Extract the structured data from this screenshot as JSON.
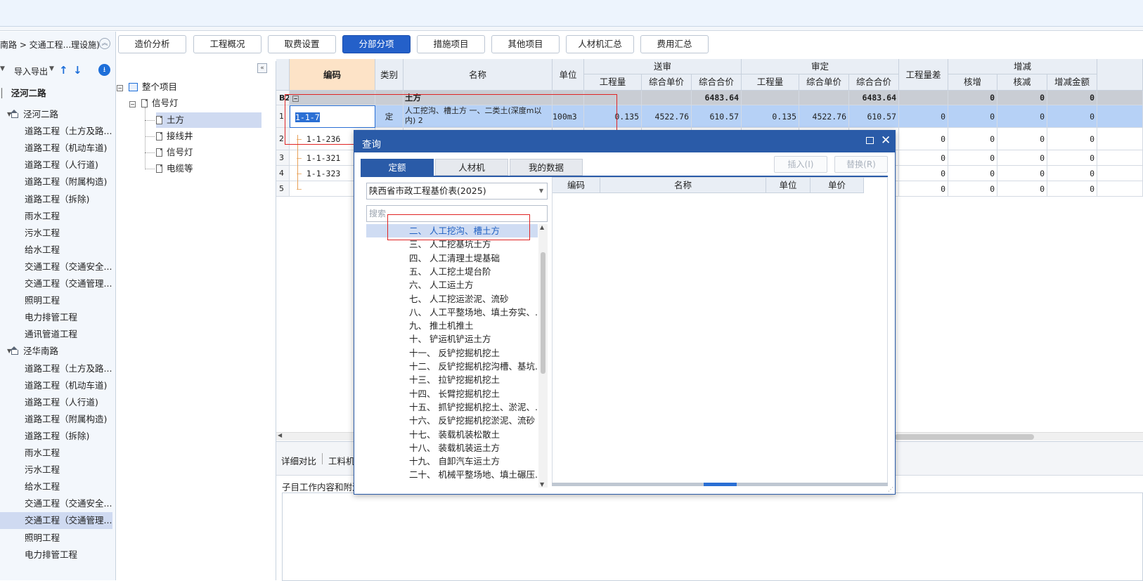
{
  "breadcrumb": "南路 > 交通工程...理设施)",
  "sidebar_toolbar": {
    "io_label": "导入导出"
  },
  "left_tree": [
    {
      "label": "泾河二路",
      "kind": "root"
    },
    {
      "label": "泾河二路",
      "kind": "group"
    },
    {
      "label": "道路工程（土方及路..."
    },
    {
      "label": "道路工程（机动车道)"
    },
    {
      "label": "道路工程（人行道)"
    },
    {
      "label": "道路工程（附属构造)"
    },
    {
      "label": "道路工程（拆除)"
    },
    {
      "label": "雨水工程"
    },
    {
      "label": "污水工程"
    },
    {
      "label": "给水工程"
    },
    {
      "label": "交通工程（交通安全..."
    },
    {
      "label": "交通工程（交通管理..."
    },
    {
      "label": "照明工程"
    },
    {
      "label": "电力排管工程"
    },
    {
      "label": "通讯管道工程"
    },
    {
      "label": "泾华南路",
      "kind": "group"
    },
    {
      "label": "道路工程（土方及路..."
    },
    {
      "label": "道路工程（机动车道)"
    },
    {
      "label": "道路工程（人行道)"
    },
    {
      "label": "道路工程（附属构造)"
    },
    {
      "label": "道路工程（拆除)"
    },
    {
      "label": "雨水工程"
    },
    {
      "label": "污水工程"
    },
    {
      "label": "给水工程"
    },
    {
      "label": "交通工程（交通安全..."
    },
    {
      "label": "交通工程（交通管理...",
      "selected": true
    },
    {
      "label": "照明工程"
    },
    {
      "label": "电力排管工程"
    }
  ],
  "project_tree": {
    "root": "整个项目",
    "node": "信号灯",
    "children": [
      "土方",
      "接线井",
      "信号灯",
      "电缆等"
    ]
  },
  "tabs": [
    "造价分析",
    "工程概况",
    "取费设置",
    "分部分项",
    "措施项目",
    "其他项目",
    "人材机汇总",
    "费用汇总"
  ],
  "active_tab": "分部分项",
  "grid": {
    "headers": {
      "code": "编码",
      "type": "类别",
      "name": "名称",
      "unit": "单位",
      "send": "送审",
      "audit": "审定",
      "diff": "工程量差",
      "change": "增减",
      "qty": "工程量",
      "uprice": "综合单价",
      "total": "综合合价",
      "inc": "核增",
      "dec": "核减",
      "amt": "增减金额"
    },
    "rows": [
      {
        "no": "B2",
        "code": "",
        "type": "",
        "name": "土方",
        "unit": "",
        "s_qty": "",
        "s_up": "",
        "s_tot": "6483.64",
        "a_qty": "",
        "a_up": "",
        "a_tot": "6483.64",
        "diff": "",
        "inc": "0",
        "dec": "0",
        "amt": "0"
      },
      {
        "no": "1",
        "code": "1-1-7",
        "type": "定",
        "name": "人工挖沟、槽土方 一、二类土(深度m以内) 2",
        "unit": "100m3",
        "s_qty": "0.135",
        "s_up": "4522.76",
        "s_tot": "610.57",
        "a_qty": "0.135",
        "a_up": "4522.76",
        "a_tot": "610.57",
        "diff": "0",
        "inc": "0",
        "dec": "0",
        "amt": "0"
      },
      {
        "no": "2",
        "code": "1-1-236",
        "diff": "0",
        "inc": "0",
        "dec": "0",
        "amt": "0"
      },
      {
        "no": "3",
        "code": "1-1-321",
        "diff": "0",
        "inc": "0",
        "dec": "0",
        "amt": "0"
      },
      {
        "no": "4",
        "code": "1-1-323",
        "diff": "0",
        "inc": "0",
        "dec": "0",
        "amt": "0"
      },
      {
        "no": "5",
        "code": "",
        "diff": "0",
        "inc": "0",
        "dec": "0",
        "amt": "0"
      }
    ]
  },
  "lower_panel": {
    "tabs": [
      "详细对比",
      "工料机"
    ],
    "notes_label": "子目工作内容和附注"
  },
  "dialog": {
    "title": "查询",
    "tabs": [
      "定额",
      "人材机",
      "我的数据"
    ],
    "insert_label": "插入(I)",
    "replace_label": "替换(R)",
    "dropdown_value": "陕西省市政工程基价表(2025)",
    "search_placeholder": "搜索",
    "list": [
      "二、 人工挖沟、槽土方",
      "三、 人工挖基坑土方",
      "四、 人工清理土堤基础",
      "五、 人工挖土堤台阶",
      "六、 人工运土方",
      "七、 人工挖运淤泥、流砂",
      "八、 人工平整场地、填土夯实、...",
      "九、 推土机推土",
      "十、 铲运机铲运土方",
      "十一、 反铲挖掘机挖土",
      "十二、 反铲挖掘机挖沟槽、基坑...",
      "十三、 拉铲挖掘机挖土",
      "十四、 长臂挖掘机挖土",
      "十五、 抓铲挖掘机挖土、淤泥、...",
      "十六、 反铲挖掘机挖淤泥、流砂",
      "十七、 装载机装松散土",
      "十八、 装载机装运土方",
      "十九、 自卸汽车运土方",
      "二十、 机械平整场地、填土碾压..."
    ],
    "result_headers": [
      "编码",
      "名称",
      "单位",
      "单价"
    ]
  },
  "colors": {
    "accent": "#2460c9",
    "dialog": "#2a5ba8",
    "annotation": "#e02424"
  }
}
